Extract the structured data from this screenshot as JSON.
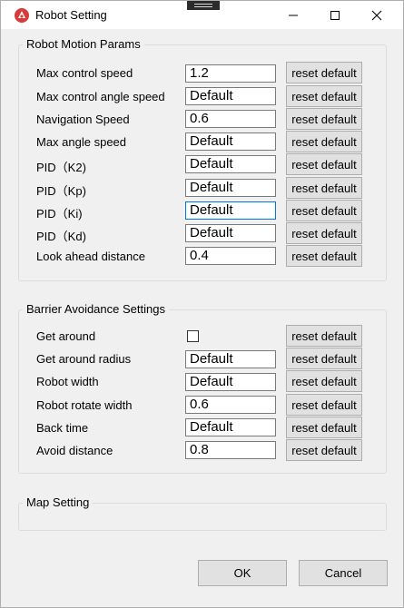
{
  "window": {
    "title": "Robot Setting"
  },
  "colors": {
    "accent_icon": "#d83b3b",
    "focus_border": "#0078d7"
  },
  "motion": {
    "legend": "Robot Motion Params",
    "reset_label": "reset default",
    "rows": [
      {
        "label": "Max control speed",
        "value": "1.2"
      },
      {
        "label": "Max control angle speed",
        "value": "Default"
      },
      {
        "label": "Navigation Speed",
        "value": "0.6"
      },
      {
        "label": "Max angle speed",
        "value": "Default"
      },
      {
        "label": "PID（K2)",
        "value": "Default"
      },
      {
        "label": "PID（Kp)",
        "value": "Default"
      },
      {
        "label": "PID（Ki)",
        "value": "Default"
      },
      {
        "label": "PID（Kd)",
        "value": "Default"
      },
      {
        "label": "Look ahead distance",
        "value": "0.4"
      }
    ]
  },
  "barrier": {
    "legend": "Barrier Avoidance Settings",
    "reset_label": "reset default",
    "get_around": {
      "label": "Get around",
      "checked": false
    },
    "rows": [
      {
        "label": "Get around radius",
        "value": "Default"
      },
      {
        "label": "Robot width",
        "value": "Default"
      },
      {
        "label": "Robot rotate width",
        "value": "0.6"
      },
      {
        "label": "Back time",
        "value": "Default"
      },
      {
        "label": "Avoid distance",
        "value": "0.8"
      }
    ]
  },
  "map": {
    "legend": "Map Setting"
  },
  "footer": {
    "ok_label": "OK",
    "cancel_label": "Cancel"
  },
  "icons": [
    "app-robot-icon",
    "minimize-icon",
    "maximize-icon",
    "close-icon"
  ]
}
